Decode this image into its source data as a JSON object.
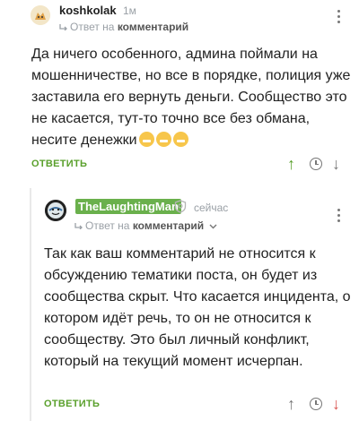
{
  "comments": [
    {
      "username": "koshkolak",
      "time": "1м",
      "reply_prefix": "Ответ на",
      "reply_target": "комментарий",
      "text": "Да ничего особенного, админа поймали на мошенничестве, но все в порядке, полиция уже заставила его вернуть деньги. Сообщество это не касается, тут-то точно все без обмана, несите денежки",
      "reply_label": "ОТВЕТИТЬ",
      "emojis": [
        "grinning-emoji",
        "grinning-emoji",
        "grinning-emoji"
      ]
    },
    {
      "username": "TheLaughtingMan",
      "time": "сейчас",
      "reply_prefix": "Ответ на",
      "reply_target": "комментарий",
      "text": "Так как ваш комментарий не относится к обсуждению тематики поста, он будет из сообщества скрыт. Что касается инцидента, о котором идёт речь, то он не относится к сообществу. Это был личный конфликт, который на текущий момент исчерпан.",
      "reply_label": "ОТВЕТИТЬ"
    }
  ],
  "colors": {
    "accent_green": "#5aa02c",
    "badge_green": "#6ab04c",
    "downvote_red": "#d9534f",
    "muted_gray": "#9aa0a6"
  }
}
